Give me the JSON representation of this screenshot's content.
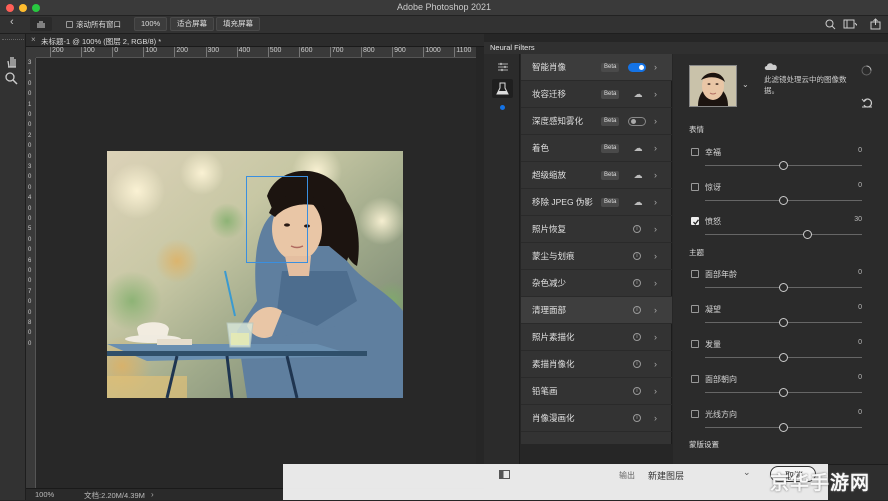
{
  "window": {
    "title": "Adobe Photoshop 2021"
  },
  "options_bar": {
    "scroll_all_windows": "滚动所有窗口",
    "zoom_value": "100%",
    "fit_screen": "适合屏幕",
    "fill_screen": "填充屏幕"
  },
  "document": {
    "tab_title": "未标题-1 @ 100% (图层 2, RGB/8) *",
    "ruler_h": [
      "200",
      "100",
      "0",
      "100",
      "200",
      "300",
      "400",
      "500",
      "600",
      "700",
      "800",
      "900",
      "1000",
      "1100"
    ],
    "ruler_v": [
      "3",
      "1",
      "0",
      "0",
      "1",
      "0",
      "0",
      "2",
      "0",
      "0",
      "3",
      "0",
      "0",
      "4",
      "0",
      "0",
      "5",
      "0",
      "0",
      "6",
      "0",
      "0",
      "7",
      "0",
      "0",
      "8",
      "0",
      "0"
    ],
    "status_zoom": "100%",
    "status_doc": "文档:2.20M/4.39M"
  },
  "neural_filters": {
    "panel_title": "Neural Filters",
    "filters": [
      {
        "name": "智能肖像",
        "beta": "Beta",
        "control": "toggle-on",
        "active": true
      },
      {
        "name": "妆容迁移",
        "beta": "Beta",
        "control": "cloud"
      },
      {
        "name": "深度感知雾化",
        "beta": "Beta",
        "control": "toggle-off"
      },
      {
        "name": "着色",
        "beta": "Beta",
        "control": "cloud"
      },
      {
        "name": "超级缩放",
        "beta": "Beta",
        "control": "cloud"
      },
      {
        "name": "移除 JPEG 伪影",
        "beta": "Beta",
        "control": "cloud"
      },
      {
        "name": "照片恢复",
        "beta": "",
        "control": "info"
      },
      {
        "name": "蒙尘与划痕",
        "beta": "",
        "control": "info"
      },
      {
        "name": "杂色减少",
        "beta": "",
        "control": "info"
      },
      {
        "name": "清理面部",
        "beta": "",
        "control": "info",
        "hover": true
      },
      {
        "name": "照片素描化",
        "beta": "",
        "control": "info"
      },
      {
        "name": "素描肖像化",
        "beta": "",
        "control": "info"
      },
      {
        "name": "铅笔画",
        "beta": "",
        "control": "info"
      },
      {
        "name": "肖像漫画化",
        "beta": "",
        "control": "info"
      }
    ],
    "settings": {
      "cloud_note": "此滤镜处理云中的图像数据。",
      "section_expression": "表情",
      "section_theme": "主题",
      "section_canvas": "蒙版设置",
      "sliders": [
        {
          "label": "幸福",
          "value": "0",
          "checked": false,
          "fraction": 0.5
        },
        {
          "label": "惊讶",
          "value": "0",
          "checked": false,
          "fraction": 0.5
        },
        {
          "label": "愤怒",
          "value": "30",
          "checked": true,
          "fraction": 0.65
        },
        {
          "label": "面部年龄",
          "value": "0",
          "checked": false,
          "fraction": 0.5
        },
        {
          "label": "凝望",
          "value": "0",
          "checked": false,
          "fraction": 0.5
        },
        {
          "label": "发量",
          "value": "0",
          "checked": false,
          "fraction": 0.5
        },
        {
          "label": "面部朝向",
          "value": "0",
          "checked": false,
          "fraction": 0.5
        },
        {
          "label": "光线方向",
          "value": "0",
          "checked": false,
          "fraction": 0.5
        }
      ]
    },
    "footer": {
      "output_label": "输出",
      "output_value": "新建图层",
      "cancel": "取消"
    }
  },
  "watermark": "京华手游网",
  "colors": {
    "accent": "#1473e6",
    "face_box": "#3a8fe0",
    "close": "#ff5f57",
    "minimize": "#febc2e",
    "zoom": "#28c840"
  },
  "icons": [
    "back-arrow-icon",
    "hand-icon",
    "zoom-tool-icon",
    "search-icon",
    "workspace-icon",
    "share-icon",
    "sliders-icon",
    "flask-icon",
    "cloud-icon",
    "chevron-right-icon",
    "chevron-down-icon",
    "info-icon",
    "reset-icon",
    "layers-compare-icon",
    "spinner-icon"
  ]
}
